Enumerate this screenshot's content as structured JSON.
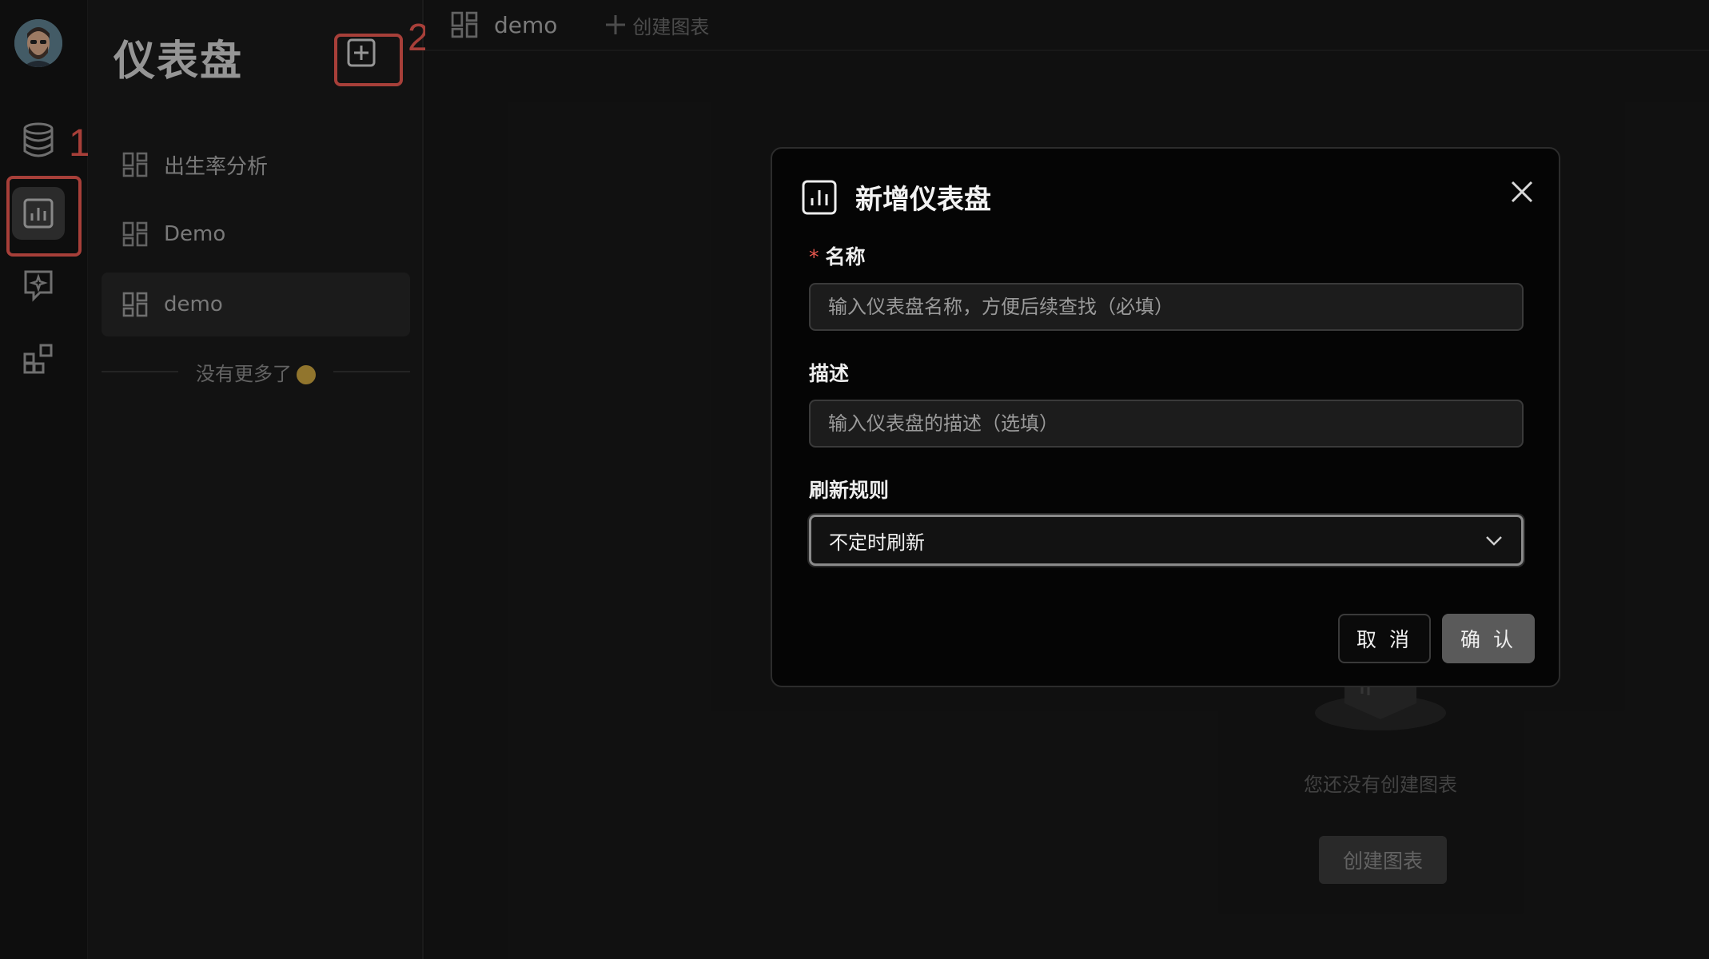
{
  "rail": {
    "items": [
      {
        "name": "database",
        "icon": "database-icon"
      },
      {
        "name": "dashboard",
        "icon": "chart-icon",
        "active": true
      },
      {
        "name": "ai-chat",
        "icon": "sparkle-chat-icon"
      },
      {
        "name": "apps",
        "icon": "grid-plus-icon"
      }
    ],
    "step1": "1"
  },
  "sidebar": {
    "title": "仪表盘",
    "step2": "2",
    "items": [
      {
        "label": "出生率分析"
      },
      {
        "label": "Demo"
      },
      {
        "label": "demo",
        "active": true
      }
    ],
    "no_more": "没有更多了"
  },
  "topbar": {
    "tab_name": "demo",
    "create_chart": "创建图表"
  },
  "empty": {
    "text": "您还没有创建图表",
    "button": "创建图表"
  },
  "modal": {
    "title": "新增仪表盘",
    "name_label": "名称",
    "required_mark": "*",
    "name_placeholder": "输入仪表盘名称，方便后续查找（必填）",
    "desc_label": "描述",
    "desc_placeholder": "输入仪表盘的描述（选填）",
    "refresh_label": "刷新规则",
    "refresh_value": "不定时刷新",
    "cancel": "取 消",
    "confirm": "确 认"
  },
  "colors": {
    "highlight": "#e8584f",
    "background": "#161616",
    "modal": "#050505"
  }
}
